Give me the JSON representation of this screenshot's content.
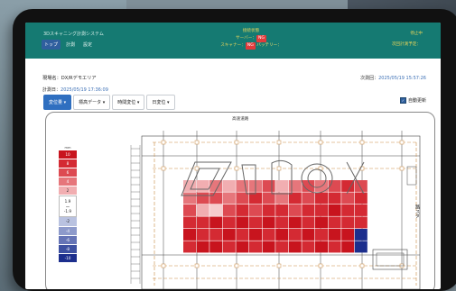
{
  "app": {
    "title": "3Dスキャニング計測システム"
  },
  "nav": {
    "items": [
      "トップ",
      "計測",
      "設定"
    ],
    "active_index": 0
  },
  "status": {
    "heading": "接続状態",
    "server_label": "サーバー：",
    "server_value": "NG",
    "scanner_label": "スキャナー：",
    "scanner_value": "NG",
    "battery_label": "バッテリー："
  },
  "header_right": {
    "state": "停止中",
    "next_plan_label": "次回計測予定："
  },
  "site": {
    "label": "現場名：",
    "value": "DX/Rデモエリア"
  },
  "measured": {
    "label": "計測日：",
    "value": "2025/05/19 17:36:09"
  },
  "next_time": {
    "label": "次測回：",
    "value": "2025/05/19 15:57:26"
  },
  "tabs": [
    "変位量",
    "標高データ",
    "時間変位",
    "日変位"
  ],
  "tab_selected": 0,
  "auto_refresh": {
    "label": "自動更新",
    "checked": true
  },
  "drawing": {
    "road_label": "高速道路",
    "right_label": "路スタ"
  },
  "legend": {
    "unit": "mm",
    "upper": [
      {
        "label": "10",
        "color": "#c8141e"
      },
      {
        "label": "8",
        "color": "#d42a33"
      },
      {
        "label": "6",
        "color": "#dd4a52"
      },
      {
        "label": "4",
        "color": "#e6767b"
      },
      {
        "label": "2",
        "color": "#f1aeb1"
      }
    ],
    "middle": [
      "1.9",
      "〜",
      "-1.9"
    ],
    "lower": [
      {
        "label": "-2",
        "color": "#b9c2e0"
      },
      {
        "label": "-4",
        "color": "#8d9acb"
      },
      {
        "label": "-6",
        "color": "#6574b6"
      },
      {
        "label": "-8",
        "color": "#3d50a1"
      },
      {
        "label": "-10",
        "color": "#1c2e8d"
      }
    ]
  },
  "heatmap": {
    "rows": [
      [
        "#f1aeb1",
        "#f1aeb1",
        "#e6767b",
        "#f1aeb1",
        "#e6767b",
        "#e6767b",
        "#dd4a52",
        "#f1aeb1",
        "#e6767b",
        "#dd4a52",
        "#e6767b",
        "#dd4a52",
        "#d42a33",
        "#dd4a52"
      ],
      [
        "#e6767b",
        "#dd4a52",
        "#dd4a52",
        "#e6767b",
        "#dd4a52",
        "#d42a33",
        "#dd4a52",
        "#e6767b",
        "#d42a33",
        "#dd4a52",
        "#d42a33",
        "#d42a33",
        "#dd4a52",
        "#d42a33"
      ],
      [
        "#dd4a52",
        "#f1aeb1",
        "#f6cccd",
        "#dd4a52",
        "#d42a33",
        "#dd4a52",
        "#d42a33",
        "#d42a33",
        "#dd4a52",
        "#d42a33",
        "#d42a33",
        "#c8141e",
        "#d42a33",
        "#d42a33"
      ],
      [
        "#d42a33",
        "#d42a33",
        "#c8141e",
        "#d42a33",
        "#c8141e",
        "#d42a33",
        "#c8141e",
        "#d42a33",
        "#c8141e",
        "#d42a33",
        "#c8141e",
        "#d42a33",
        "#d42a33",
        "#d42a33"
      ],
      [
        "#c8141e",
        "#d42a33",
        "#d42a33",
        "#c8141e",
        "#d42a33",
        "#c8141e",
        "#d42a33",
        "#c8141e",
        "#d42a33",
        "#c8141e",
        "#d42a33",
        "#c8141e",
        "#c8141e",
        "#1c2e8d"
      ],
      [
        "#d42a33",
        "#c8141e",
        "#c8141e",
        "#d42a33",
        "#c8141e",
        "#d42a33",
        "#c8141e",
        "#d42a33",
        "#c8141e",
        "#d42a33",
        "#c8141e",
        "#d42a33",
        "#c8141e",
        "#1c2e8d"
      ]
    ]
  }
}
